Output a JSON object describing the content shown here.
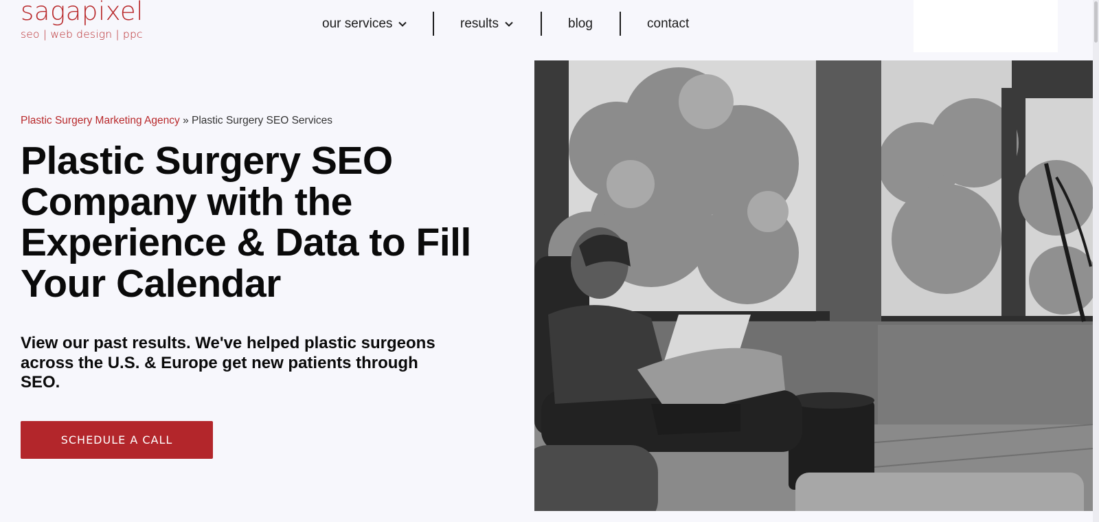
{
  "brand": {
    "name": "sagapixel",
    "tagline": "seo | web design | ppc",
    "color": "#b8282a"
  },
  "nav": {
    "items": [
      {
        "label": "our services",
        "has_dropdown": true
      },
      {
        "label": "results",
        "has_dropdown": true
      },
      {
        "label": "blog",
        "has_dropdown": false
      },
      {
        "label": "contact",
        "has_dropdown": false
      }
    ]
  },
  "breadcrumb": {
    "parent": "Plastic Surgery Marketing Agency",
    "separator": "»",
    "current": "Plastic Surgery SEO Services"
  },
  "hero": {
    "heading": "Plastic Surgery SEO Company with the Experience & Data to Fill Your Calendar",
    "subheading": "View our past results. We've helped plastic surgeons across the U.S. & Europe get new patients through SEO.",
    "cta_label": "SCHEDULE A CALL",
    "cta_color": "#b3262b"
  },
  "photo": {
    "subject": "woman-with-laptop-in-office-photo",
    "style": "black-and-white"
  }
}
